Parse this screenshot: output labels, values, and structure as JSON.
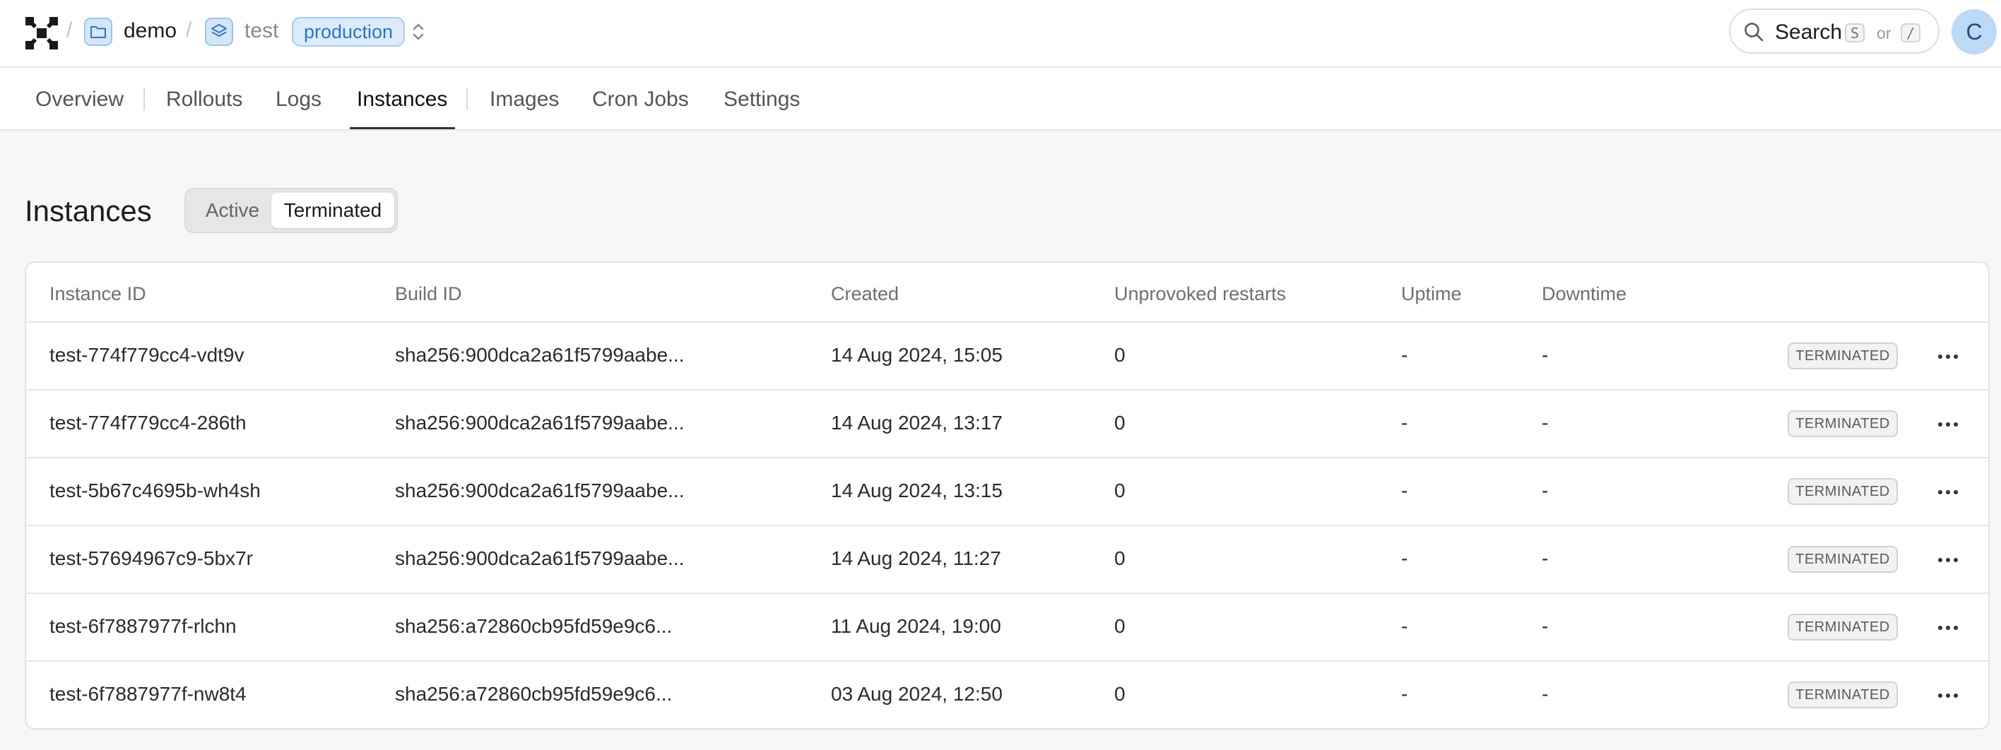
{
  "breadcrumb": {
    "project": "demo",
    "service": "test",
    "environment": "production"
  },
  "search": {
    "label": "Search",
    "shortcut1": "S",
    "or": "or",
    "shortcut2": "/"
  },
  "user": {
    "initial": "C"
  },
  "tabs": [
    {
      "label": "Overview"
    },
    {
      "label": "Rollouts"
    },
    {
      "label": "Logs"
    },
    {
      "label": "Instances",
      "active": true
    },
    {
      "label": "Images"
    },
    {
      "label": "Cron Jobs"
    },
    {
      "label": "Settings"
    }
  ],
  "page": {
    "title": "Instances",
    "filter": {
      "active": "Active",
      "terminated": "Terminated",
      "selected": "Terminated"
    }
  },
  "table": {
    "columns": [
      "Instance ID",
      "Build ID",
      "Created",
      "Unprovoked restarts",
      "Uptime",
      "Downtime"
    ],
    "rows": [
      {
        "instance_id": "test-774f779cc4-vdt9v",
        "build_id": "sha256:900dca2a61f5799aabe...",
        "created": "14 Aug 2024, 15:05",
        "restarts": "0",
        "uptime": "-",
        "downtime": "-",
        "status": "TERMINATED"
      },
      {
        "instance_id": "test-774f779cc4-286th",
        "build_id": "sha256:900dca2a61f5799aabe...",
        "created": "14 Aug 2024, 13:17",
        "restarts": "0",
        "uptime": "-",
        "downtime": "-",
        "status": "TERMINATED"
      },
      {
        "instance_id": "test-5b67c4695b-wh4sh",
        "build_id": "sha256:900dca2a61f5799aabe...",
        "created": "14 Aug 2024, 13:15",
        "restarts": "0",
        "uptime": "-",
        "downtime": "-",
        "status": "TERMINATED"
      },
      {
        "instance_id": "test-57694967c9-5bx7r",
        "build_id": "sha256:900dca2a61f5799aabe...",
        "created": "14 Aug 2024, 11:27",
        "restarts": "0",
        "uptime": "-",
        "downtime": "-",
        "status": "TERMINATED"
      },
      {
        "instance_id": "test-6f7887977f-rlchn",
        "build_id": "sha256:a72860cb95fd59e9c6...",
        "created": "11 Aug 2024, 19:00",
        "restarts": "0",
        "uptime": "-",
        "downtime": "-",
        "status": "TERMINATED"
      },
      {
        "instance_id": "test-6f7887977f-nw8t4",
        "build_id": "sha256:a72860cb95fd59e9c6...",
        "created": "03 Aug 2024, 12:50",
        "restarts": "0",
        "uptime": "-",
        "downtime": "-",
        "status": "TERMINATED"
      }
    ]
  },
  "icons": {
    "logo": "logo-icon",
    "project": "folder-icon",
    "service": "layers-icon",
    "switcher": "chevron-up-down-icon",
    "search": "search-icon",
    "row_menu": "more-horizontal-icon"
  },
  "colors": {
    "accent": "#2d74c4",
    "badge_bg": "#dcebfb",
    "page_bg": "#f7f7f7"
  }
}
